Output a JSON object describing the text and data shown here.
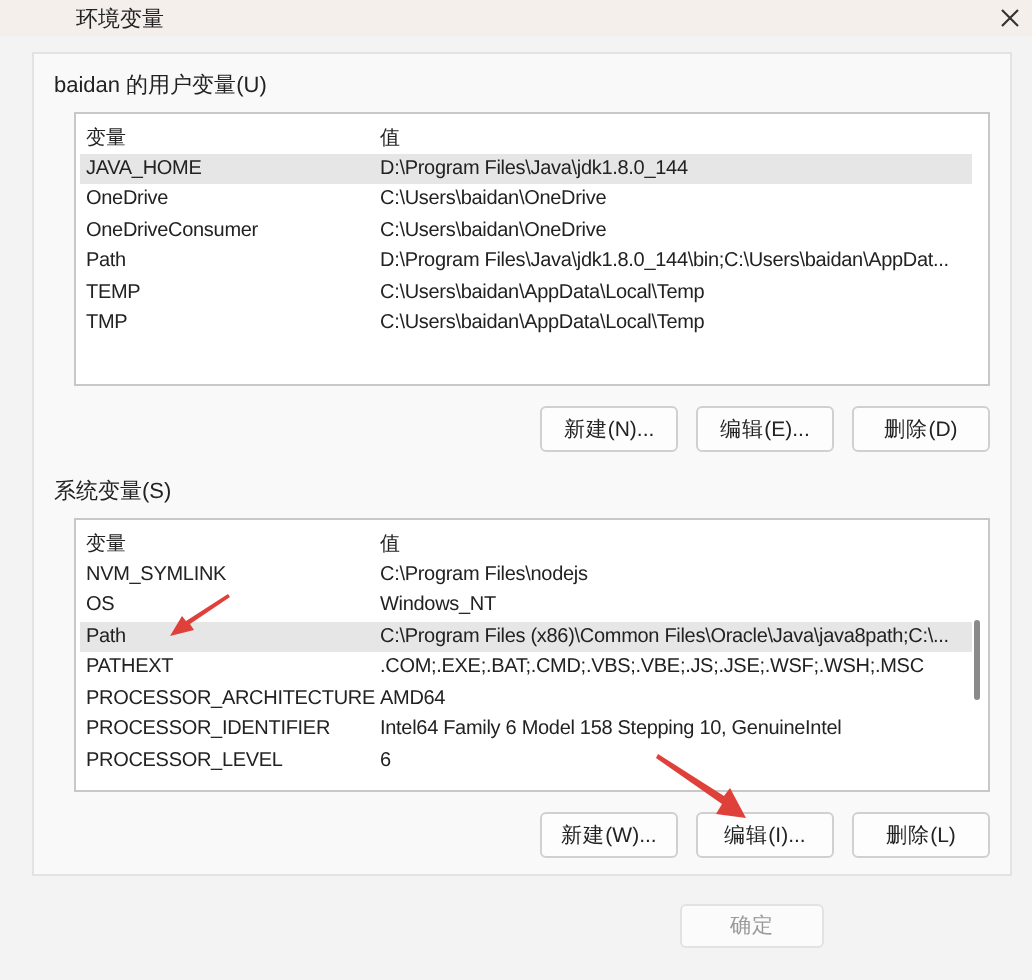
{
  "window": {
    "title": "环境变量"
  },
  "user_variables": {
    "label": "baidan 的用户变量(U)",
    "columns": [
      "变量",
      "值"
    ],
    "rows": [
      {
        "name": "JAVA_HOME",
        "value": "D:\\Program Files\\Java\\jdk1.8.0_144",
        "selected": true
      },
      {
        "name": "OneDrive",
        "value": "C:\\Users\\baidan\\OneDrive",
        "selected": false
      },
      {
        "name": "OneDriveConsumer",
        "value": "C:\\Users\\baidan\\OneDrive",
        "selected": false
      },
      {
        "name": "Path",
        "value": "D:\\Program Files\\Java\\jdk1.8.0_144\\bin;C:\\Users\\baidan\\AppDat...",
        "selected": false
      },
      {
        "name": "TEMP",
        "value": "C:\\Users\\baidan\\AppData\\Local\\Temp",
        "selected": false
      },
      {
        "name": "TMP",
        "value": "C:\\Users\\baidan\\AppData\\Local\\Temp",
        "selected": false
      }
    ],
    "buttons": [
      "新建(N)...",
      "编辑(E)...",
      "删除(D)"
    ]
  },
  "system_variables": {
    "label": "系统变量(S)",
    "columns": [
      "变量",
      "值"
    ],
    "rows": [
      {
        "name": "NVM_SYMLINK",
        "value": "C:\\Program Files\\nodejs",
        "selected": false
      },
      {
        "name": "OS",
        "value": "Windows_NT",
        "selected": false
      },
      {
        "name": "Path",
        "value": "C:\\Program Files (x86)\\Common Files\\Oracle\\Java\\java8path;C:\\...",
        "selected": true
      },
      {
        "name": "PATHEXT",
        "value": ".COM;.EXE;.BAT;.CMD;.VBS;.VBE;.JS;.JSE;.WSF;.WSH;.MSC",
        "selected": false
      },
      {
        "name": "PROCESSOR_ARCHITECTURE",
        "value": "AMD64",
        "selected": false
      },
      {
        "name": "PROCESSOR_IDENTIFIER",
        "value": "Intel64 Family 6 Model 158 Stepping 10, GenuineIntel",
        "selected": false
      },
      {
        "name": "PROCESSOR_LEVEL",
        "value": "6",
        "selected": false
      }
    ],
    "buttons": [
      "新建(W)...",
      "编辑(I)...",
      "删除(L)"
    ]
  },
  "ok_button": "确定"
}
